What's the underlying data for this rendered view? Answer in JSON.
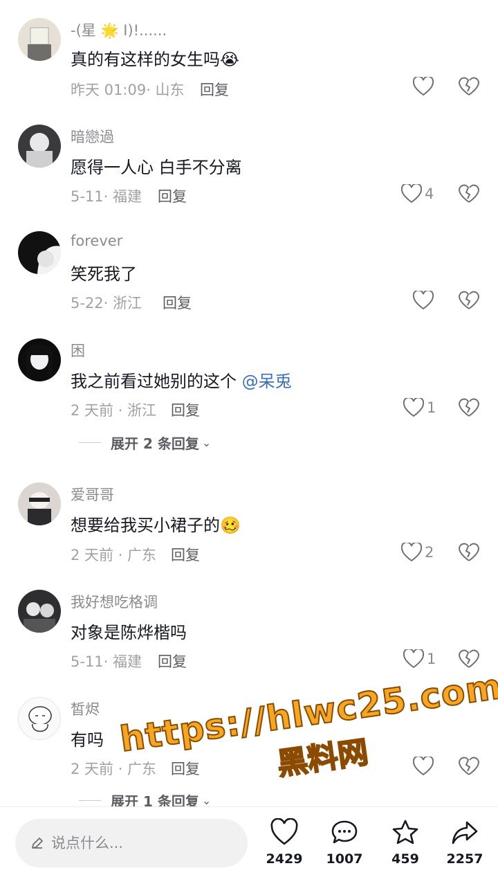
{
  "comments": [
    {
      "username": "-(星 🌟 I)!......",
      "text": "真的有这样的女生吗😭",
      "meta": "昨天 01:09· 山东",
      "reply": "回复",
      "likes": ""
    },
    {
      "username": "暗戀過",
      "text": "愿得一人心 白手不分离",
      "meta": "5-11· 福建",
      "reply": "回复",
      "likes": "4"
    },
    {
      "username": "forever",
      "text": "笑死我了",
      "meta": "5-22· 浙江",
      "reply": "回复",
      "likes": ""
    },
    {
      "username": "困",
      "text": "我之前看过她别的这个 ",
      "mention": "@呆兎",
      "meta": "2 天前 · 浙江",
      "reply": "回复",
      "likes": "1",
      "expand": "展开 2 条回复"
    },
    {
      "username": "爱哥哥",
      "text": "想要给我买小裙子的🥴",
      "meta": "2 天前 · 广东",
      "reply": "回复",
      "likes": "2"
    },
    {
      "username": "我好想吃格调",
      "text": "对象是陈烨楷吗",
      "meta": "5-11· 福建",
      "reply": "回复",
      "likes": "1"
    },
    {
      "username": "皙烬",
      "text": "有吗",
      "meta": "2 天前 · 广东",
      "reply": "回复",
      "likes": "",
      "expand": "展开 1 条回复"
    }
  ],
  "bottom_bar": {
    "input_placeholder": "说点什么...",
    "like_count": "2429",
    "comment_count": "1007",
    "favorite_count": "459",
    "share_count": "2257"
  },
  "watermark": {
    "url": "https://hlwc25.com",
    "name": "黑料网"
  },
  "colors": {
    "mention": "#3b6fb6",
    "watermark_fill": "#f5a623",
    "watermark_stroke": "#8a4b00"
  }
}
